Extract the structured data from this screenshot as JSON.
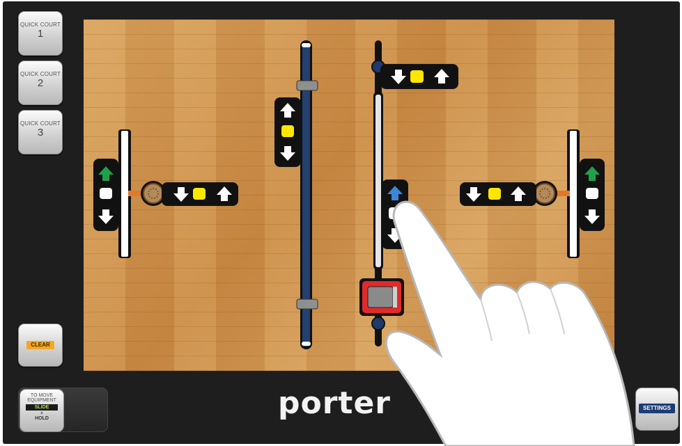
{
  "sidebar": {
    "quick_court_buttons": [
      {
        "label": "QUICK COURT",
        "number": "1"
      },
      {
        "label": "QUICK COURT",
        "number": "2"
      },
      {
        "label": "QUICK COURT",
        "number": "3"
      }
    ],
    "clear_label": "CLEAR"
  },
  "move_equipment": {
    "line1": "TO MOVE",
    "line2": "EQUIPMENT",
    "slide": "SLIDE",
    "plus": "+",
    "hold": "HOLD"
  },
  "footer": {
    "brand": "porter",
    "settings_label": "SETTINGS"
  },
  "colors": {
    "accent_clear": "#f5a623",
    "settings_blue": "#1c3c75",
    "divider_blue": "#24406f",
    "up_green": "#21a04b",
    "active_blue": "#3d86d6",
    "hold_yellow": "#ffe600",
    "motor_red": "#e12a2a"
  },
  "icons": [
    "arrow-up-icon",
    "arrow-down-icon",
    "stop-icon",
    "hoop-icon",
    "hand-pointer-icon"
  ]
}
